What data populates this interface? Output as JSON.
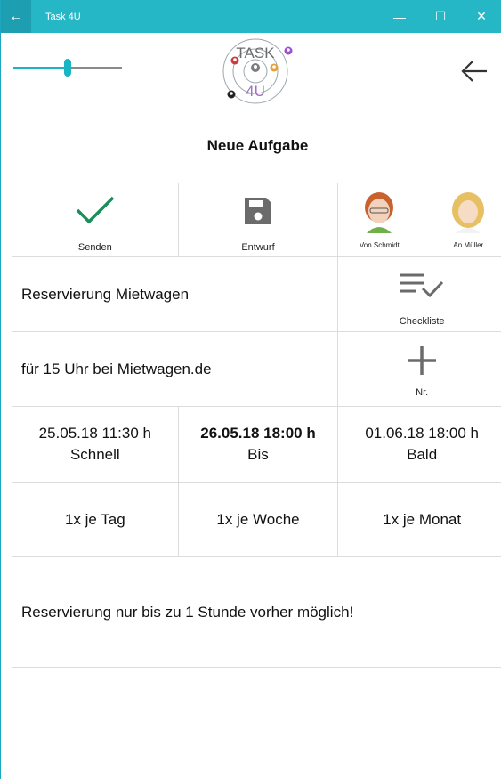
{
  "window": {
    "title": "Task 4U",
    "back_glyph": "←",
    "minimize_glyph": "—",
    "maximize_glyph": "☐",
    "close_glyph": "✕"
  },
  "header": {
    "slider_value": 0.5,
    "logo_text_top": "TASK",
    "logo_text_bottom": "4U",
    "back_icon": "arrow-left-icon"
  },
  "page_title": "Neue Aufgabe",
  "actions": {
    "send_label": "Senden",
    "draft_label": "Entwurf",
    "from_label": "Von Schmidt",
    "to_label": "An Müller"
  },
  "task": {
    "title": "Reservierung Mietwagen",
    "checklist_label": "Checkliste",
    "detail": "für 15 Uhr bei Mietwagen.de",
    "number_label": "Nr."
  },
  "deadlines": [
    {
      "date": "25.05.18 11:30 h",
      "label": "Schnell"
    },
    {
      "date": "26.05.18 18:00 h",
      "label": "Bis"
    },
    {
      "date": "01.06.18 18:00 h",
      "label": "Bald"
    }
  ],
  "frequency": {
    "daily": "1x je Tag",
    "weekly": "1x je Woche",
    "monthly": "1x je Monat"
  },
  "note": "Reservierung nur bis zu 1 Stunde vorher möglich!",
  "colors": {
    "titlebar": "#26b7c6",
    "accent": "#19b5c4",
    "check_green": "#1a8f5a",
    "icon_gray": "#6b6b6b"
  }
}
